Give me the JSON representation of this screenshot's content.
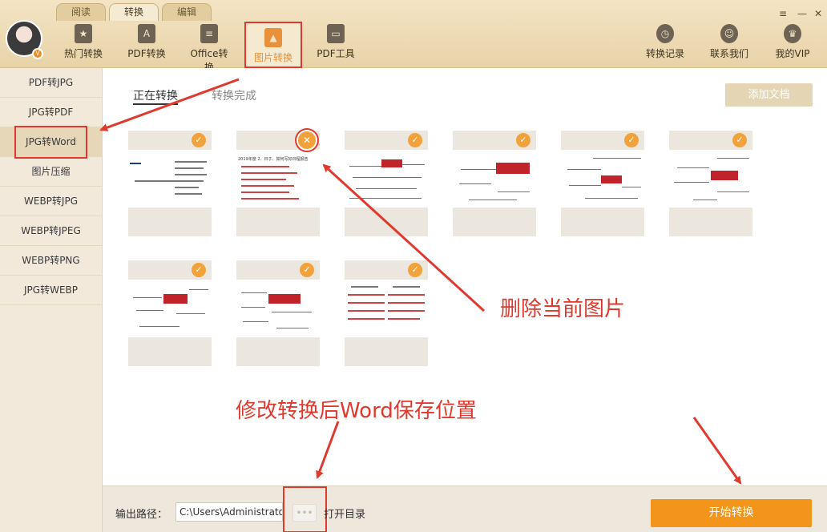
{
  "top_tabs": [
    "阅读",
    "转换",
    "编辑"
  ],
  "nav": {
    "items": [
      "热门转换",
      "PDF转换",
      "Office转换",
      "图片转换",
      "PDF工具"
    ],
    "right_items": [
      "转换记录",
      "联系我们",
      "我的VIP"
    ]
  },
  "sidebar": {
    "items": [
      "PDF转JPG",
      "JPG转PDF",
      "JPG转Word",
      "图片压缩",
      "WEBP转JPG",
      "WEBP转JPEG",
      "WEBP转PNG",
      "JPG转WEBP"
    ]
  },
  "main": {
    "tabs": [
      "正在转换",
      "转换完成"
    ],
    "add_button": "添加文档",
    "thumb_doc_title": "2019年度 2、日子、如何写好日程报告"
  },
  "bottom": {
    "output_label": "输出路径：",
    "output_path": "C:\\Users\\Administrator",
    "browse_dots": "•••",
    "open_dir": "打开目录",
    "start_button": "开始转换"
  },
  "annotations": {
    "delete": "删除当前图片",
    "save_location": "修改转换后Word保存位置"
  },
  "colors": {
    "accent": "#f3941b",
    "annotation": "#e03a2e",
    "topbar": "#e8d3a8"
  }
}
